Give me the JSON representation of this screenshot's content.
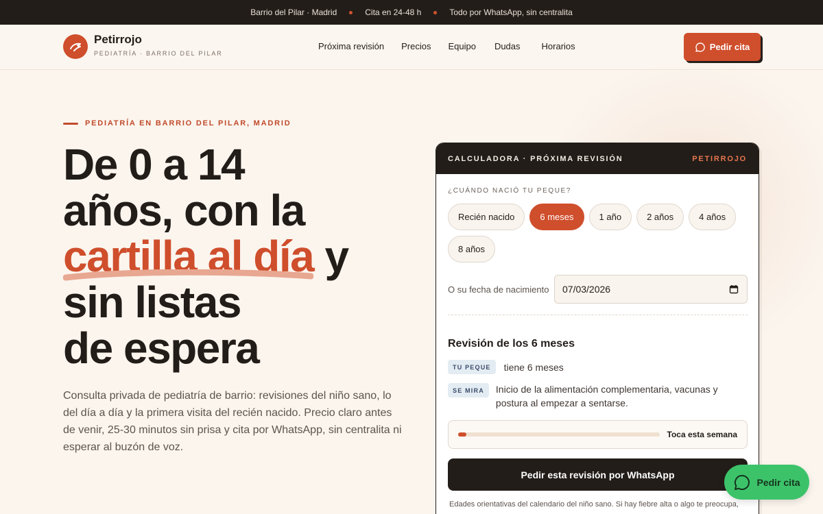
{
  "topbar": {
    "items": [
      "Barrio del Pilar · Madrid",
      "Cita en 24-48 h",
      "Todo por WhatsApp, sin centralita"
    ]
  },
  "header": {
    "brand": "Petirrojo",
    "brand_sub": "PEDIATRÍA · BARRIO DEL PILAR",
    "nav": [
      "Próxima revisión",
      "Precios",
      "Equipo",
      "Dudas",
      "Horarios"
    ],
    "cta": "Pedir cita"
  },
  "hero": {
    "eyebrow": "PEDIATRÍA EN BARRIO DEL PILAR, MADRID",
    "title_line1": "De 0 a 14",
    "title_line2": "años, con la",
    "title_accent": "cartilla al día",
    "title_after_accent": " y",
    "title_line4": "sin listas",
    "title_line5": "de espera",
    "lead": "Consulta privada de pediatría de barrio: revisiones del niño sano, lo del día a día y la primera visita del recién nacido. Precio claro antes de venir, 25-30 minutos sin prisa y cita por WhatsApp, sin centralita ni esperar al buzón de voz."
  },
  "calculator": {
    "title": "CALCULADORA · PRÓXIMA REVISIÓN",
    "badge": "PETIRROJO",
    "question": "¿CUÁNDO NACIÓ TU PEQUE?",
    "options": [
      "Recién nacido",
      "6 meses",
      "1 año",
      "2 años",
      "4 años",
      "8 años"
    ],
    "selected": "6 meses",
    "date_label": "O su fecha de nacimiento",
    "date_value": "07/03/2026",
    "result_title": "Revisión de los 6 meses",
    "tag_age": "TU PEQUE",
    "age_text": "tiene 6 meses",
    "tag_check": "SE MIRA",
    "check_text": "Inicio de la alimentación complementaria, vacunas y postura al empezar a sentarse.",
    "progress_fraction": 0.04,
    "progress_label": "Toca esta semana",
    "book_button": "Pedir esta revisión por WhatsApp",
    "footnote": "Edades orientativas del calendario del niño sano. Si hay fiebre alta o algo te preocupa,"
  },
  "floating_cta": {
    "label": "Pedir cita"
  },
  "colors": {
    "accent": "#cf4e2c",
    "dark": "#231d19",
    "whatsapp": "#3cc36a",
    "cream": "#fbf5ee"
  },
  "icons": {
    "logo": "robin-bird-icon",
    "chat": "chat-bubble-icon",
    "calendar": "calendar-icon"
  }
}
